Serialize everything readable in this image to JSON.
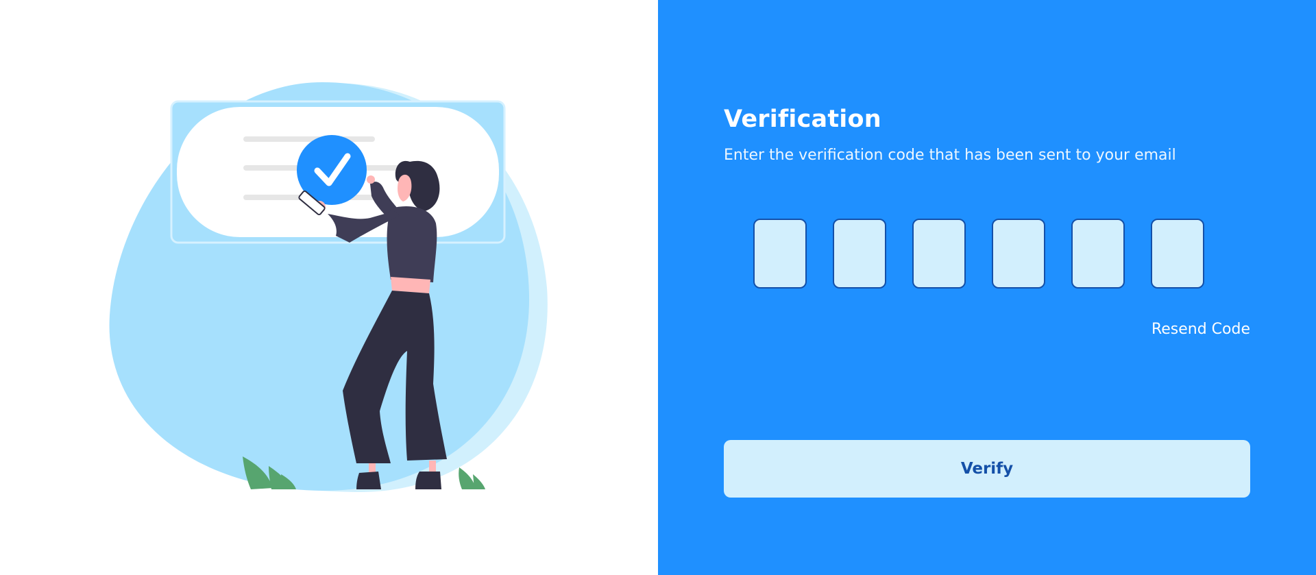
{
  "colors": {
    "accent": "#1f90ff",
    "input_fill": "#d2effd",
    "input_border": "#1450a8",
    "button_text": "#1450a8"
  },
  "illustration": {
    "icon": "check-badge-icon",
    "description_icon": "person-with-phone-illustration"
  },
  "verification": {
    "title": "Verification",
    "subtitle": "Enter the verification code that has been sent to your email",
    "code_length": 6,
    "code_values": [
      "",
      "",
      "",
      "",
      "",
      ""
    ],
    "resend_label": "Resend Code",
    "verify_label": "Verify"
  }
}
